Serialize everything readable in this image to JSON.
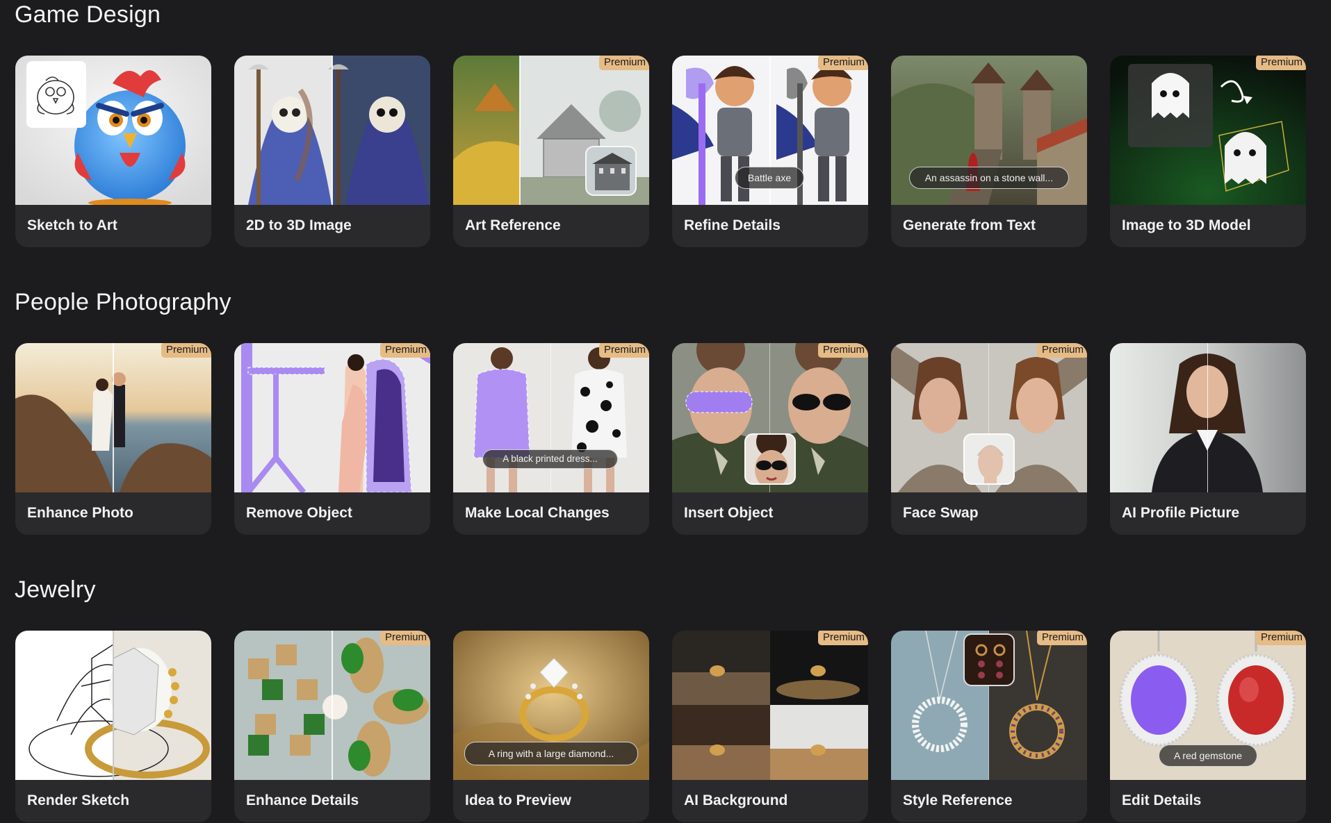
{
  "sections": [
    {
      "title": "Game Design",
      "cards": [
        {
          "label": "Sketch to Art",
          "premium": false
        },
        {
          "label": "2D to 3D Image",
          "premium": false
        },
        {
          "label": "Art Reference",
          "premium": true
        },
        {
          "label": "Refine Details",
          "premium": true,
          "pill": "Battle axe"
        },
        {
          "label": "Generate from Text",
          "premium": false,
          "pill": "An assassin on a stone wall..."
        },
        {
          "label": "Image to 3D Model",
          "premium": true
        }
      ]
    },
    {
      "title": "People Photography",
      "cards": [
        {
          "label": "Enhance Photo",
          "premium": true
        },
        {
          "label": "Remove Object",
          "premium": true
        },
        {
          "label": "Make Local Changes",
          "premium": true,
          "pill": "A black printed dress..."
        },
        {
          "label": "Insert Object",
          "premium": true
        },
        {
          "label": "Face Swap",
          "premium": true
        },
        {
          "label": "AI Profile Picture",
          "premium": false
        }
      ]
    },
    {
      "title": "Jewelry",
      "cards": [
        {
          "label": "Render Sketch",
          "premium": false
        },
        {
          "label": "Enhance Details",
          "premium": true
        },
        {
          "label": "Idea to Preview",
          "premium": false,
          "pill": "A ring with a large diamond..."
        },
        {
          "label": "AI Background",
          "premium": true
        },
        {
          "label": "Style Reference",
          "premium": true
        },
        {
          "label": "Edit Details",
          "premium": true,
          "pill": "A red gemstone"
        }
      ]
    }
  ],
  "badge_text": "Premium",
  "colors": {
    "background": "#1c1c1e",
    "card": "#2a2a2c",
    "premium": "#e6bb86",
    "mask": "#9b6cf0"
  }
}
